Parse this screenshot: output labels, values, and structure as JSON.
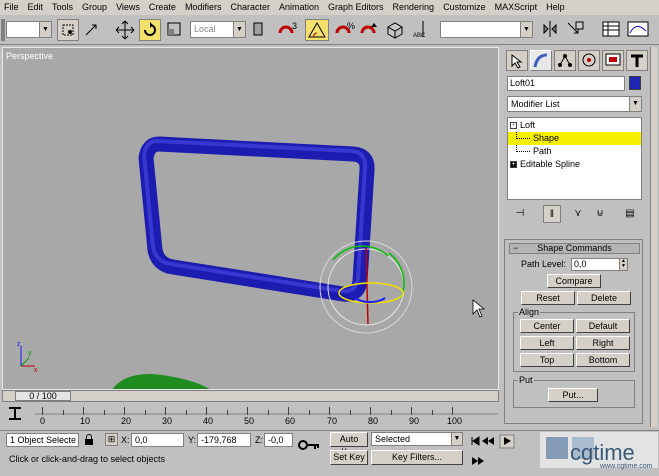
{
  "menubar": {
    "items": [
      "File",
      "Edit",
      "Tools",
      "Group",
      "Views",
      "Create",
      "Modifiers",
      "Character",
      "Animation",
      "Graph Editors",
      "Rendering",
      "Customize",
      "MAXScript",
      "Help"
    ]
  },
  "toolbar": {
    "selection_filter": "",
    "ref_coord": "Local",
    "named_selection": ""
  },
  "viewport": {
    "label": "Perspective",
    "axis": {
      "x": "x",
      "y": "y",
      "z": "z"
    }
  },
  "command_panel": {
    "object_name": "Loft01",
    "object_color": "#1e24b4",
    "modifier_list": "Modifier List",
    "stack": [
      {
        "label": "Loft",
        "expander": "-"
      },
      {
        "label": "Shape",
        "selected": true
      },
      {
        "label": "Path"
      },
      {
        "label": "Editable Spline",
        "expander": "+"
      }
    ],
    "rollout": {
      "title": "Shape Commands",
      "path_level_label": "Path Level:",
      "path_level_value": "0,0",
      "compare": "Compare",
      "reset": "Reset",
      "delete": "Delete",
      "align_group": "Align",
      "center": "Center",
      "default": "Default",
      "left": "Left",
      "right": "Right",
      "top": "Top",
      "bottom": "Bottom",
      "put_group": "Put",
      "put": "Put..."
    }
  },
  "timeline": {
    "slider_label": "0 / 100",
    "ticks": [
      "0",
      "10",
      "20",
      "30",
      "40",
      "50",
      "60",
      "70",
      "80",
      "90",
      "100"
    ]
  },
  "status": {
    "selection": "1 Object Selecte",
    "x_label": "X:",
    "x_value": "0,0",
    "y_label": "Y:",
    "y_value": "-179,768",
    "z_label": "Z:",
    "z_value": "-0,0",
    "auto_key": "Auto Key",
    "set_key": "Set Key",
    "key_mode": "Selected",
    "key_filters": "Key Filters...",
    "prompt": "Click or click-and-drag to select objects"
  },
  "watermark": {
    "brand": "cgtime",
    "url": "www.cgtime.com"
  }
}
